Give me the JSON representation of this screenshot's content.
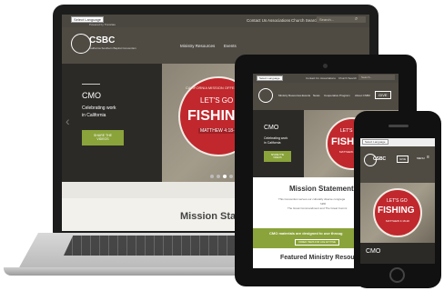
{
  "laptop": {
    "lang_select": "Select Language",
    "powered_by": "Powered by Translate",
    "top_links": [
      "Contact Us",
      "Associations",
      "Church Search"
    ],
    "search_placeholder": "Search...",
    "logo_text": "CSBC",
    "logo_sub": "California Southern Baptist Convention",
    "nav": [
      "Ministry Resources",
      "Events"
    ],
    "hero_title": "CMO",
    "hero_text_1": "Celebrating work",
    "hero_text_2": "in California",
    "hero_button_1": "SHARE THE",
    "hero_button_2": "VIDEOS",
    "ribbon": "CALIFORNIA MISSION OFFERING",
    "lets_go": "LET'S GO",
    "fishing": "FISHING",
    "verse": "MATTHEW 4:18-20",
    "mission_heading": "Mission Statem"
  },
  "tablet": {
    "lang_select": "Select Language",
    "top_links": [
      "Contact Us",
      "Associations",
      "Church Search"
    ],
    "search_placeholder": "Search...",
    "nav": [
      "Ministry Resources",
      "Events",
      "News",
      "Cooperative Program",
      "About CSBC"
    ],
    "give_label": "GIVE",
    "hero_title": "CMO",
    "hero_text_1": "Celebrating work",
    "hero_text_2": "in California",
    "hero_button_1": "SHARE THE",
    "hero_button_2": "VIDEOS",
    "lets_go": "LET'S GO",
    "fishing": "FISHING",
    "verse": "MATTHEW 4:18-20",
    "mission_heading": "Mission Statement",
    "mission_text_1": "This Convention serves our culturally diverse congrega",
    "mission_text_2": "fulfill",
    "mission_text_3": "The Great Commandment and The Great Commi",
    "cmo_banner": "CMO materials are designed to use throug",
    "cmo_button": "ORDER ITEMS FOR LIFE ANYTIME",
    "featured_heading": "Featured Ministry Resou"
  },
  "phone": {
    "lang_select": "Select Language",
    "logo_text": "CSBC",
    "give_label": "GIVE",
    "menu_label": "MENU",
    "lets_go": "LET'S GO",
    "fishing": "FISHING",
    "verse": "MATTHEW 4:18-20",
    "hero_title": "CMO"
  }
}
